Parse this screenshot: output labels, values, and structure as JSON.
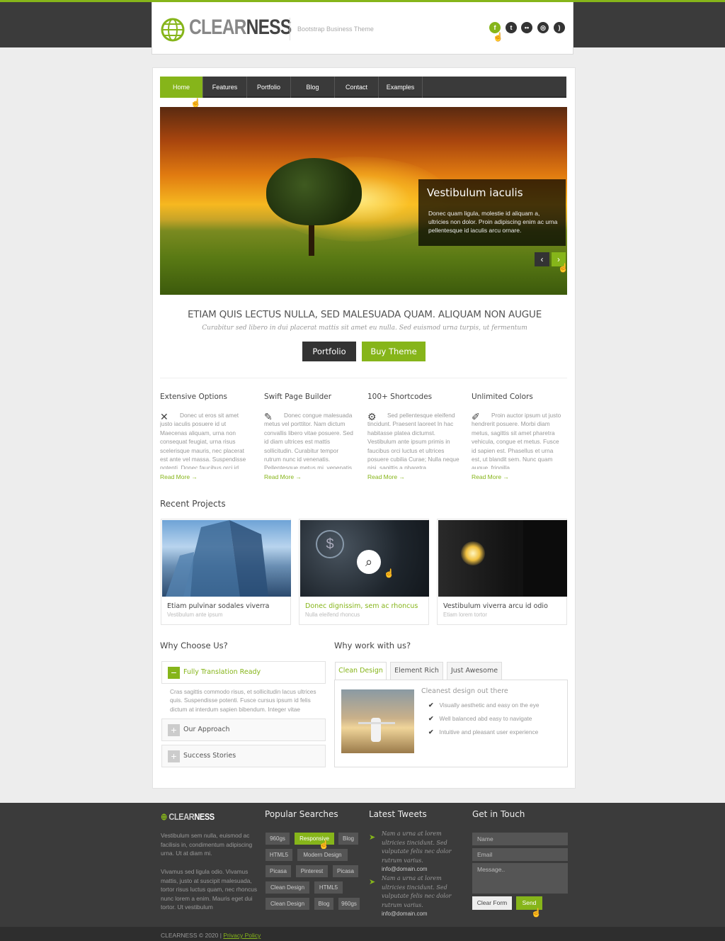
{
  "header": {
    "logo_part1": "CLEAR",
    "logo_part2": "NESS",
    "tagline": "Bootstrap Business Theme",
    "social_icons": [
      "facebook-icon",
      "twitter-icon",
      "flickr-icon",
      "dribbble-icon",
      "rss-icon"
    ]
  },
  "nav": {
    "items": [
      "Home",
      "Features",
      "Portfolio",
      "Blog",
      "Contact",
      "Examples"
    ],
    "active": "Home"
  },
  "slider": {
    "caption_title": "Vestibulum iaculis",
    "caption_text": "Donec quam ligula, molestie id aliquam a, ultricies non dolor. Proin adipiscing enim ac urna pellentesque id iaculis arcu ornare.",
    "prev": "‹",
    "next": "›"
  },
  "hero": {
    "title": "ETIAM QUIS LECTUS NULLA, SED MALESUADA QUAM. ALIQUAM NON AUGUE",
    "subtitle": "Curabitur sed libero in dui placerat mattis sit amet eu nulla. Sed euismod urna turpis, ut fermentum",
    "btn_portfolio": "Portfolio",
    "btn_buy": "Buy Theme"
  },
  "features": [
    {
      "title": "Extensive Options",
      "icon": "tools-icon",
      "text": "Donec ut eros sit amet justo iaculis posuere id ut Maecenas aliquam, urna non consequat feugiat, urna risus scelerisque mauris, nec placerat est ante vel massa. Suspendisse potenti. Donec faucibus orci id",
      "more": "Read More →"
    },
    {
      "title": "Swift Page Builder",
      "icon": "edit-icon",
      "text": "Donec congue malesuada metus vel porttitor. Nam dictum convallis libero vitae posuere. Sed id diam ultrices est mattis sollicitudin. Curabitur tempor rutrum nunc id venenatis. Pellentesque metus mi, venenatis",
      "more": "Read More →"
    },
    {
      "title": "100+ Shortcodes",
      "icon": "gears-icon",
      "text": "Sed pellentesque eleifend tincidunt. Praesent laoreet In hac habitasse platea dictumst. Vestibulum ante ipsum primis in faucibus orci luctus et ultrices posuere cubilia Curae; Nulla neque nisi, sagittis a pharetra",
      "more": "Read More →"
    },
    {
      "title": "Unlimited Colors",
      "icon": "brush-icon",
      "text": "Proin auctor ipsum ut justo hendrerit posuere. Morbi diam metus, sagittis sit amet pharetra vehicula, congue et metus. Fusce id sapien est. Phasellus et urna est, ut blandit sem. Nunc quam augue, fringilla",
      "more": "Read More →"
    }
  ],
  "recent_projects": {
    "title": "Recent Projects",
    "items": [
      {
        "title": "Etiam pulvinar sodales viverra",
        "sub": "Vestibulum ante ipsum",
        "image": "skyscraper"
      },
      {
        "title": "Donec dignissim, sem ac rhoncus",
        "sub": "Nulla eleifend rhoncus",
        "image": "business-dollar"
      },
      {
        "title": "Vestibulum viverra arcu id odio",
        "sub": "Etiam lorem tortor",
        "image": "lightbulb"
      }
    ]
  },
  "why": {
    "title": "Why Choose Us?",
    "items": [
      {
        "label": "Fully Translation Ready",
        "open": true,
        "icon": "−"
      },
      {
        "label": "Our Approach",
        "open": false,
        "icon": "+"
      },
      {
        "label": "Success Stories",
        "open": false,
        "icon": "+"
      }
    ],
    "open_text": "Cras sagittis commodo risus, et sollicitudin lacus ultrices quis. Suspendisse potenti. Fusce cursus ipsum id felis dictum at interdum sapien bibendum. Integer vitae"
  },
  "work": {
    "title": "Why work with us?",
    "tabs": [
      "Clean Design",
      "Element Rich",
      "Just Awesome"
    ],
    "active_tab": "Clean Design",
    "panel_heading": "Cleanest design out there",
    "checks": [
      "Visually aesthetic and easy on the eye",
      "Well balanced abd easy to navigate",
      "Intuitive and pleasant user experience"
    ]
  },
  "footer": {
    "logo_part1": "CLEAR",
    "logo_part2": "NESS",
    "about1": "Vestibulum sem nulla, euismod ac facilisis in, condimentum adipiscing urna. Ut at diam mi.",
    "about2": "Vivamus sed ligula odio. Vivamus mattis, justo at suscipit malesuada, tortor risus luctus quam, nec rhoncus nunc lorem a enim. Mauris eget dui tortor. Ut vestibulum",
    "popular_title": "Popular Searches",
    "tags": [
      [
        "960gs",
        "Responsive",
        "Blog"
      ],
      [
        "HTML5",
        "Modern Design"
      ],
      [
        "Picasa",
        "Pinterest",
        "Picasa"
      ],
      [
        "Clean Design",
        "HTML5"
      ],
      [
        "Clean Design",
        "Blog",
        "960gs"
      ]
    ],
    "active_tag": "Responsive",
    "tweets_title": "Latest Tweets",
    "tweets": [
      {
        "text": "Nam a urna at lorem ultricies tincidunt. Sed vulputate felis nec dolor rutrum varius.",
        "mail": "info@domain.com"
      },
      {
        "text": "Nam a urna at lorem ultricies tincidunt. Sed vulputate felis nec dolor rutrum varius.",
        "mail": "info@domain.com"
      }
    ],
    "contact_title": "Get in Touch",
    "name_ph": "Name",
    "email_ph": "Email",
    "message_ph": "Message..",
    "clear_btn": "Clear Form",
    "send_btn": "Send",
    "copyright": "CLEARNESS  © 2020  |",
    "privacy": "Privacy Policy"
  },
  "colors": {
    "accent": "#86b51a",
    "dark": "#3b3b3b"
  }
}
